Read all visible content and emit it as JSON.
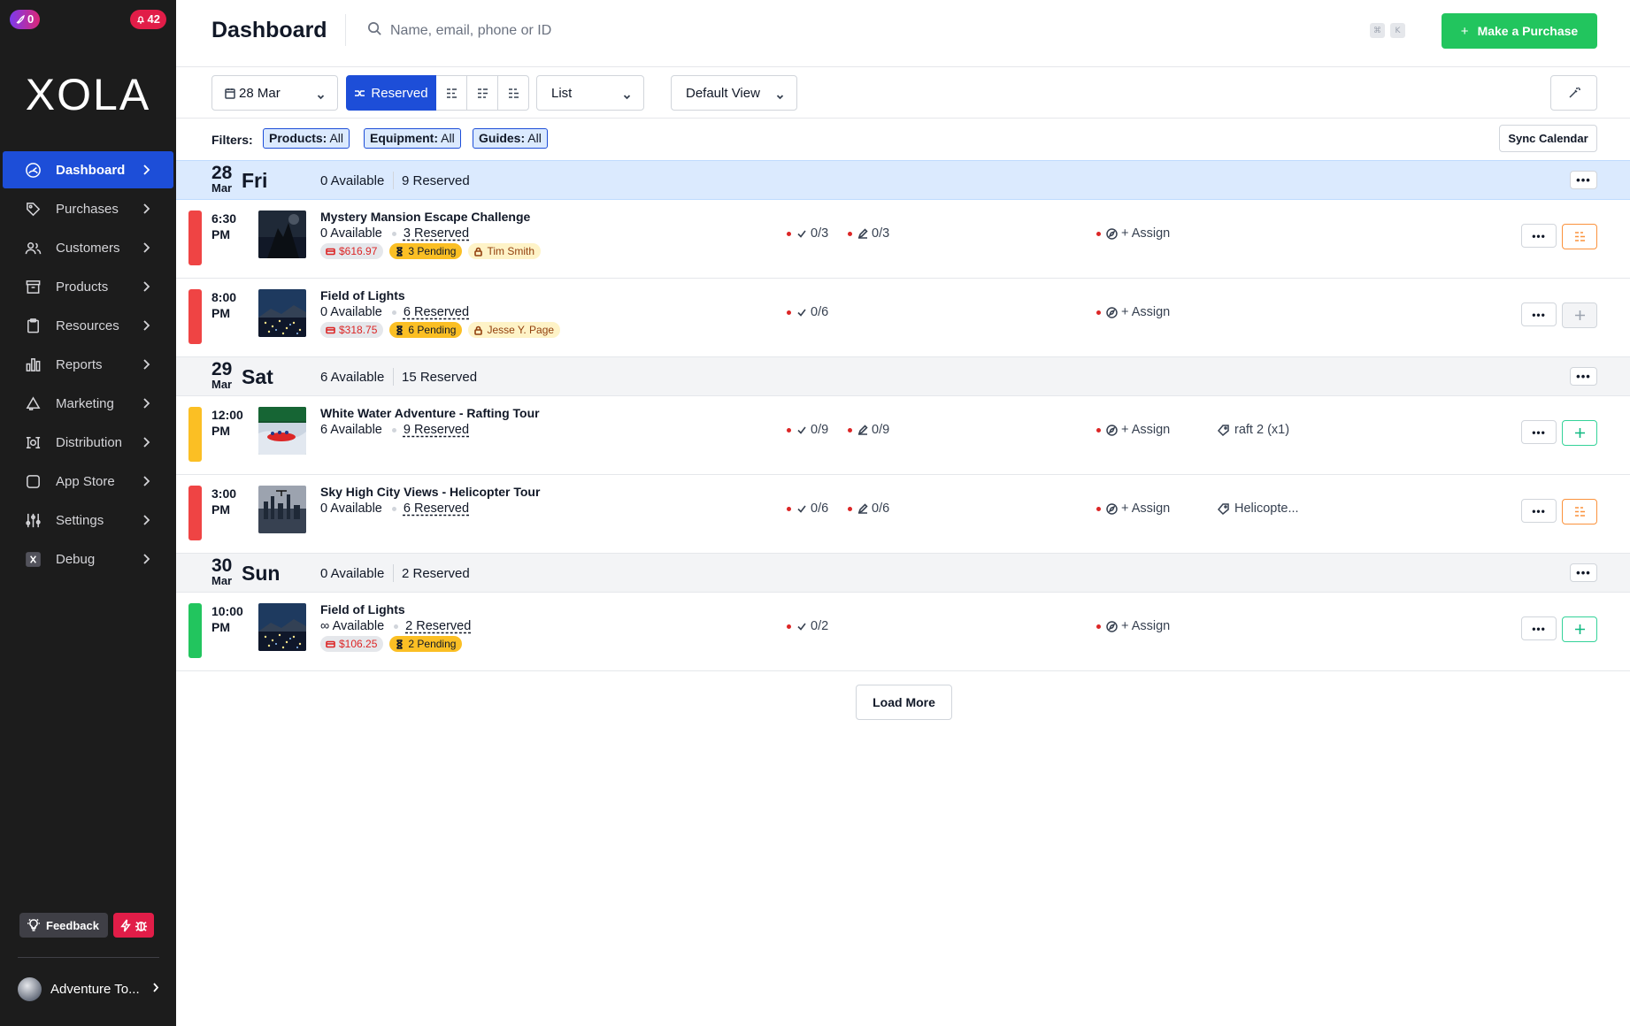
{
  "sidebar": {
    "badge_left": "0",
    "badge_right": "42",
    "logo": "XOLA",
    "items": [
      {
        "label": "Dashboard",
        "icon": "dashboard-icon",
        "active": true
      },
      {
        "label": "Purchases",
        "icon": "tag-icon"
      },
      {
        "label": "Customers",
        "icon": "users-icon"
      },
      {
        "label": "Products",
        "icon": "box-icon"
      },
      {
        "label": "Resources",
        "icon": "clipboard-icon"
      },
      {
        "label": "Reports",
        "icon": "bar-chart-icon"
      },
      {
        "label": "Marketing",
        "icon": "megaphone-icon"
      },
      {
        "label": "Distribution",
        "icon": "distribution-icon"
      },
      {
        "label": "App Store",
        "icon": "app-store-icon"
      },
      {
        "label": "Settings",
        "icon": "sliders-icon"
      },
      {
        "label": "Debug",
        "icon": "debug-icon"
      }
    ],
    "feedback_label": "Feedback",
    "account_name": "Adventure To..."
  },
  "header": {
    "title": "Dashboard",
    "search_placeholder": "Name, email, phone or ID",
    "kbd_1": "⌘",
    "kbd_2": "K",
    "purchase_label": "Make a Purchase"
  },
  "toolbar": {
    "date": "28 Mar",
    "reserved_label": "Reserved",
    "view_mode": "List",
    "saved_view": "Default View"
  },
  "filters": {
    "label": "Filters:",
    "chips": [
      {
        "key": "Products:",
        "value": "All"
      },
      {
        "key": "Equipment:",
        "value": "All"
      },
      {
        "key": "Guides:",
        "value": "All"
      }
    ],
    "sync_label": "Sync Calendar"
  },
  "days": [
    {
      "num": "28",
      "mon": "Mar",
      "dow": "Fri",
      "available": "0 Available",
      "reserved": "9 Reserved"
    },
    {
      "num": "29",
      "mon": "Mar",
      "dow": "Sat",
      "available": "6 Available",
      "reserved": "15 Reserved"
    },
    {
      "num": "30",
      "mon": "Mar",
      "dow": "Sun",
      "available": "0 Available",
      "reserved": "2 Reserved"
    }
  ],
  "events": [
    {
      "time1": "6:30",
      "time2": "PM",
      "title": "Mystery Mansion Escape Challenge",
      "available": "0 Available",
      "reserved": "3 Reserved",
      "price": "$616.97",
      "pending": "3 Pending",
      "guide": "Tim Smith",
      "checkin": "0/3",
      "waiver": "0/3",
      "assign": "+ Assign",
      "equipment": "",
      "bar_color": "#ef4444"
    },
    {
      "time1": "8:00",
      "time2": "PM",
      "title": "Field of Lights",
      "available": "0 Available",
      "reserved": "6 Reserved",
      "price": "$318.75",
      "pending": "6 Pending",
      "guide": "Jesse Y. Page",
      "checkin": "0/6",
      "waiver": "",
      "assign": "+ Assign",
      "equipment": "",
      "bar_color": "#ef4444"
    },
    {
      "time1": "12:00",
      "time2": "PM",
      "title": "White Water Adventure - Rafting Tour",
      "available": "6 Available",
      "reserved": "9 Reserved",
      "price": "",
      "pending": "",
      "guide": "",
      "checkin": "0/9",
      "waiver": "0/9",
      "assign": "+ Assign",
      "equipment": "raft 2 (x1)",
      "bar_color": "#fbbf24"
    },
    {
      "time1": "3:00",
      "time2": "PM",
      "title": "Sky High City Views - Helicopter Tour",
      "available": "0 Available",
      "reserved": "6 Reserved",
      "price": "",
      "pending": "",
      "guide": "",
      "checkin": "0/6",
      "waiver": "0/6",
      "assign": "+ Assign",
      "equipment": "Helicopte...",
      "bar_color": "#ef4444"
    },
    {
      "time1": "10:00",
      "time2": "PM",
      "title": "Field of Lights",
      "available": "∞ Available",
      "reserved": "2 Reserved",
      "price": "$106.25",
      "pending": "2 Pending",
      "guide": "",
      "checkin": "0/2",
      "waiver": "",
      "assign": "+ Assign",
      "equipment": "",
      "bar_color": "#22c55e"
    }
  ],
  "load_more_label": "Load More",
  "colors": {
    "accent": "#1d4ed8",
    "green": "#22c55e",
    "sidebar": "#1c1c1c",
    "danger": "#e11d48"
  }
}
